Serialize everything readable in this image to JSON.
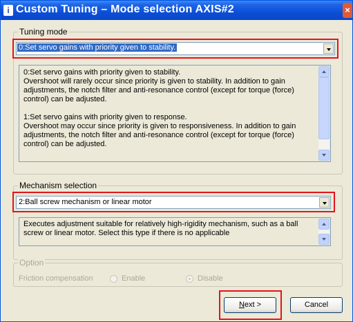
{
  "window": {
    "title": "Custom Tuning – Mode selection AXIS#2",
    "close_glyph": "×",
    "icon_glyph": "i"
  },
  "tuning_mode": {
    "label": "Tuning mode",
    "selected": "0:Set servo gains with priority given to stability.",
    "description": "0:Set servo gains with priority given to stability.\nOvershoot will rarely occur since priority is given to stability. In addition to gain adjustments, the notch filter and anti-resonance control (except for torque (force) control) can be adjusted.\n\n1:Set servo gains with priority given to response.\nOvershoot may occur since priority is given to responsiveness. In addition to gain adjustments, the notch filter and anti-resonance control (except for torque (force) control) can be adjusted."
  },
  "mechanism_selection": {
    "label": "Mechanism selection",
    "selected": "2:Ball screw mechanism or linear motor",
    "description": "Executes adjustment suitable for relatively high-rigidity mechanism, such as a ball screw or linear motor. Select this type if there is no applicable"
  },
  "option": {
    "label": "Option",
    "friction_label": "Friction compensation",
    "enable_label": "Enable",
    "disable_label": "Disable",
    "selected": "Disable"
  },
  "buttons": {
    "next_mnemonic": "N",
    "next_rest": "ext >",
    "cancel": "Cancel"
  },
  "colors": {
    "highlight_box": "#e3131b",
    "title_bar": "#0b4fd8",
    "selection": "#316ac5"
  }
}
